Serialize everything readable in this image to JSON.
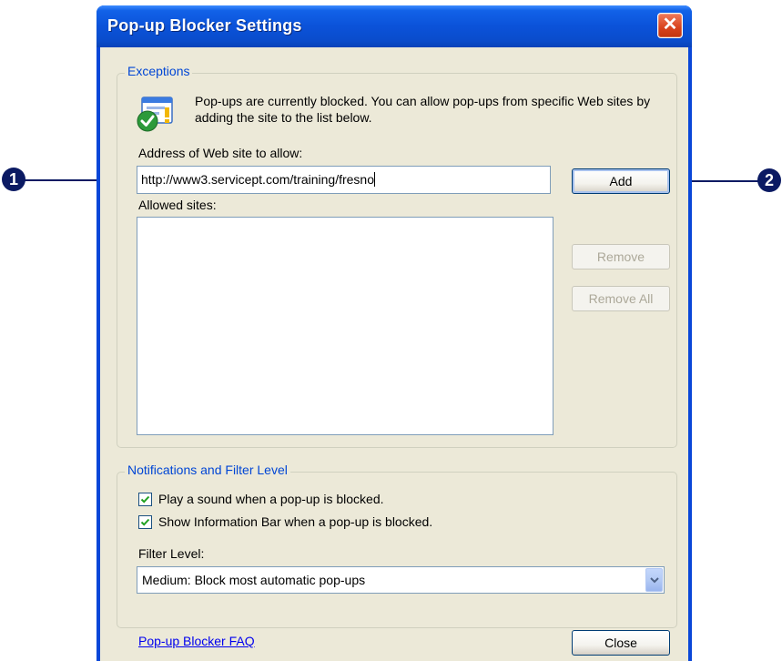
{
  "window": {
    "title": "Pop-up Blocker Settings",
    "close_glyph": "✕"
  },
  "exceptions": {
    "legend": "Exceptions",
    "icon": "popup-blocked-shield-icon",
    "info_text": "Pop-ups are currently blocked.  You can allow pop-ups from specific Web sites by adding the site to the list below.",
    "address_label": "Address of Web site to allow:",
    "address_value": "http://www3.servicept.com/training/fresno",
    "add_label": "Add",
    "allowed_label": "Allowed sites:",
    "allowed_sites": [],
    "remove_label": "Remove",
    "remove_all_label": "Remove All"
  },
  "notifications": {
    "legend": "Notifications and Filter Level",
    "play_sound": {
      "label": "Play a sound when a pop-up is blocked.",
      "checked": true
    },
    "show_info_bar": {
      "label": "Show Information Bar when a pop-up is blocked.",
      "checked": true
    },
    "filter_label": "Filter Level:",
    "filter_value": "Medium: Block most automatic pop-ups"
  },
  "footer": {
    "faq_link": "Pop-up Blocker FAQ",
    "close_label": "Close"
  },
  "callouts": [
    {
      "number": "1",
      "target": "address-textbox"
    },
    {
      "number": "2",
      "target": "add-button"
    }
  ],
  "colors": {
    "title_bar": "#0b52d9",
    "legend_text": "#0046d5",
    "callout": "#0b1a63",
    "dialog_bg": "#ece9d8"
  }
}
